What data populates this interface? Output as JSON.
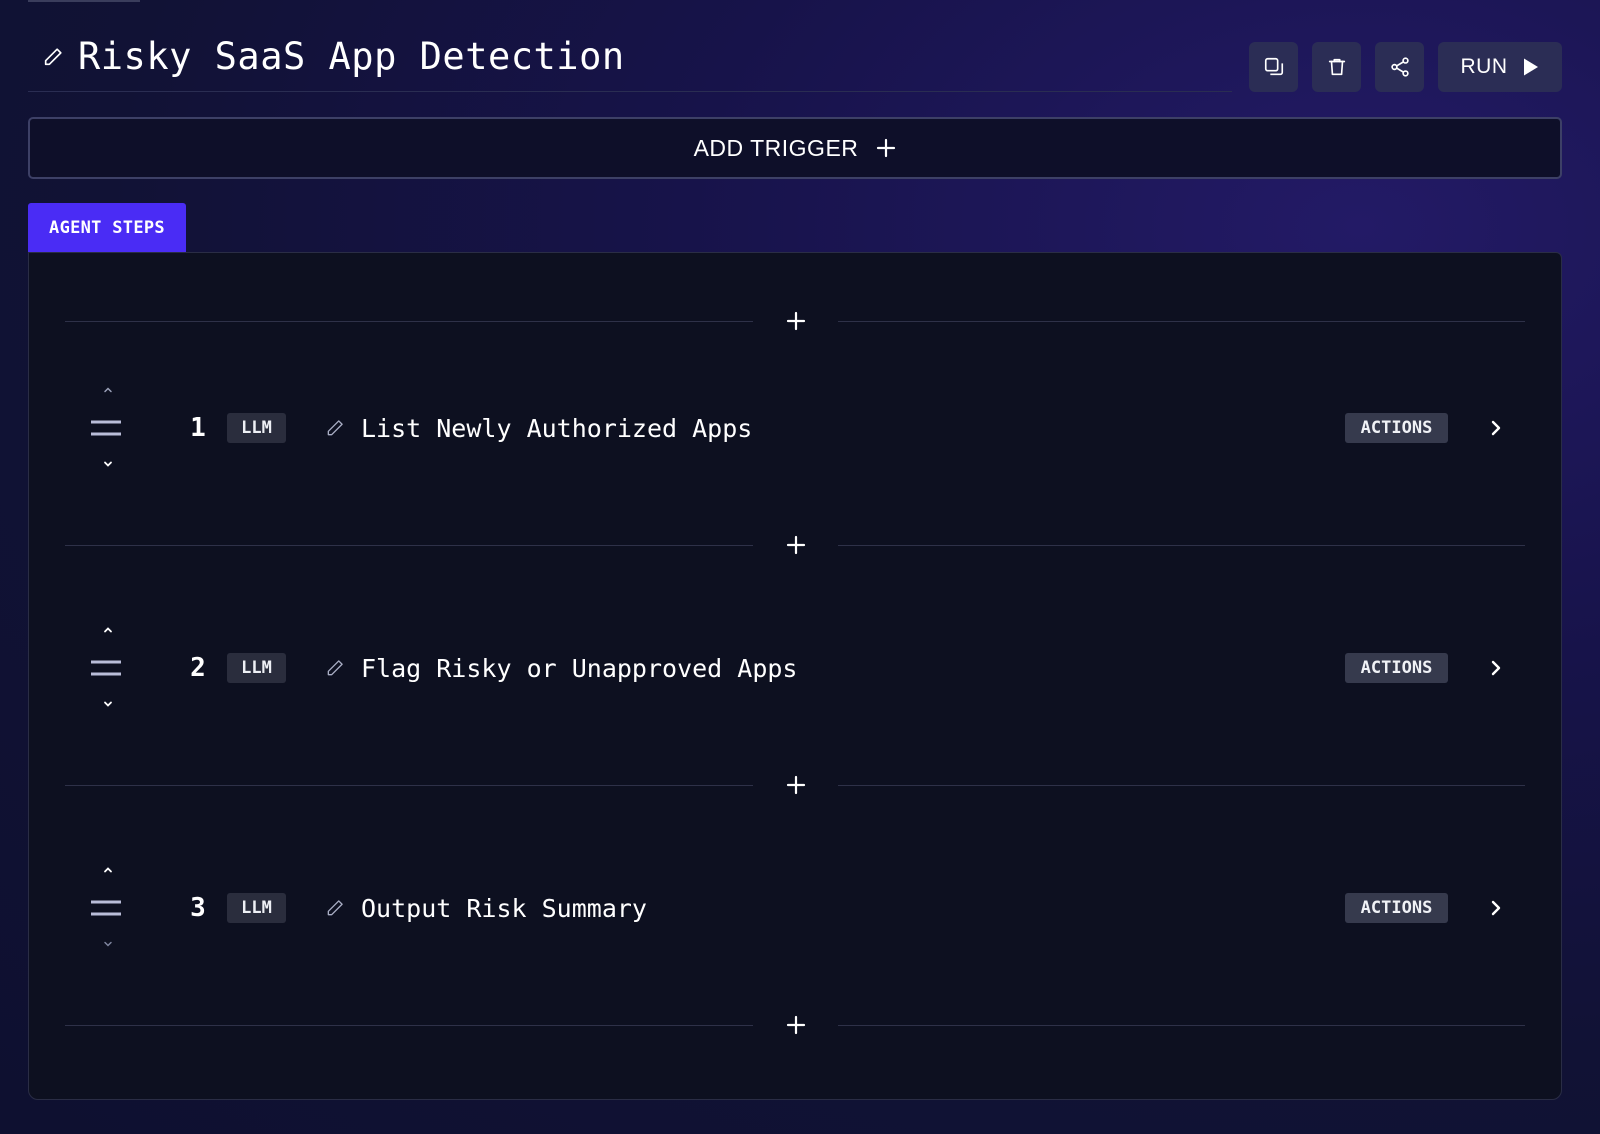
{
  "header": {
    "title": "Risky SaaS App Detection",
    "icons": {
      "edit": "pencil-icon",
      "duplicate": "copy-icon",
      "delete": "trash-icon",
      "share": "share-icon",
      "run": "play-icon"
    },
    "run_label": "RUN"
  },
  "trigger": {
    "add_label": "ADD TRIGGER",
    "icon": "plus-icon"
  },
  "agent_steps": {
    "tab_label": "AGENT STEPS",
    "steps": [
      {
        "number": "1",
        "type": "LLM",
        "name": "List Newly Authorized Apps",
        "actions_label": "ACTIONS"
      },
      {
        "number": "2",
        "type": "LLM",
        "name": "Flag Risky or Unapproved Apps",
        "actions_label": "ACTIONS"
      },
      {
        "number": "3",
        "type": "LLM",
        "name": "Output Risk Summary",
        "actions_label": "ACTIONS"
      }
    ]
  },
  "colors": {
    "accent": "#4a2cf5",
    "panel_bg": "#0d1020",
    "button_bg": "#2b2d55",
    "badge_bg": "#2a2d3d",
    "actions_bg": "#363a4d"
  }
}
